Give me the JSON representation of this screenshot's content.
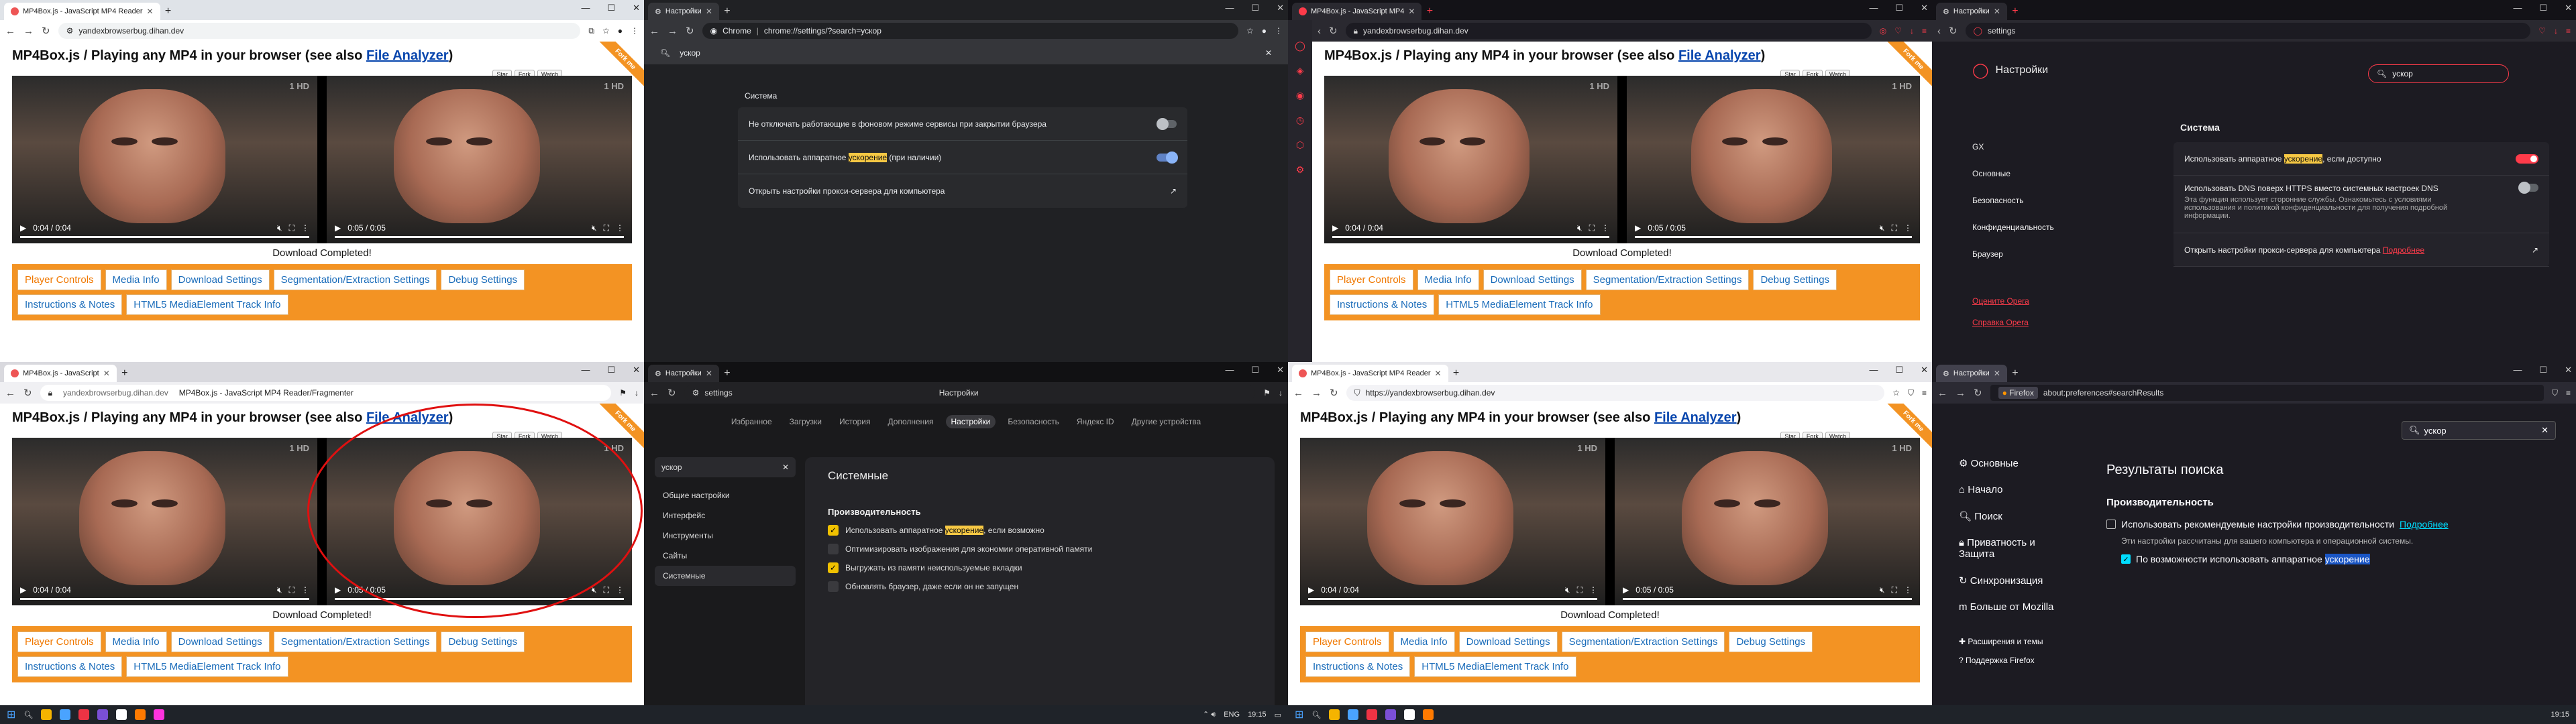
{
  "mp4page": {
    "title_prefix": "MP4Box.js / Playing any MP4 in your browser (see also ",
    "title_link": "File Analyzer",
    "title_suffix": ")",
    "ribbon": "Fork me",
    "gh_star": "Star",
    "gh_fork": "Fork",
    "gh_watch": "Watch",
    "time1": "0:04 / 0:04",
    "time2": "0:05 / 0:05",
    "download_text": "Download Completed!",
    "tabs": [
      "Player Controls",
      "Media Info",
      "Download Settings",
      "Segmentation/Extraction Settings",
      "Debug Settings",
      "Instructions & Notes",
      "HTML5 MediaElement Track Info"
    ],
    "tv_logo": "1 HD",
    "badge": "ЖИЗНИ"
  },
  "win_tl": {
    "tab": "MP4Box.js - JavaScript MP4 Reader",
    "url": "yandexbrowserbug.dihan.dev"
  },
  "win_chrome_settings": {
    "tab": "Настройки",
    "url_prefix": "Chrome",
    "url": "chrome://settings/?search=ускор",
    "search": "ускор",
    "section": "Система",
    "row1": "Не отключать работающие в фоновом режиме сервисы при закрытии браузера",
    "row2_a": "Использовать аппаратное ",
    "row2_hl": "ускорение",
    "row2_b": " (при наличии)",
    "row3": "Открыть настройки прокси-сервера для компьютера"
  },
  "win_opera_mp4": {
    "tab": "MP4Box.js - JavaScript MP4",
    "url": "yandexbrowserbug.dihan.dev"
  },
  "win_opera_settings": {
    "tab": "Настройки",
    "url": "settings",
    "header": "Настройки",
    "search": "ускор",
    "nav": [
      "GX",
      "Основные",
      "Безопасность",
      "Конфиденциальность",
      "Браузер"
    ],
    "links": [
      "Оцените Opera",
      "Справка Opera"
    ],
    "section": "Система",
    "row1_a": "Использовать аппаратное ",
    "row1_hl": "ускорение",
    "row1_b": ", если доступно",
    "row2_title": "Использовать DNS поверх HTTPS вместо системных настроек DNS",
    "row2_desc": "Эта функция использует сторонние службы. Ознакомьтесь с условиями использования и политикой конфиденциальности для получения подробной информации.",
    "row3": "Открыть настройки прокси-сервера для компьютера",
    "row3_link": "Подробнее"
  },
  "win_yandex_mp4": {
    "tab": "MP4Box.js - JavaScript",
    "url": "yandexbrowserbug.dihan.dev",
    "page_title": "MP4Box.js - JavaScript MP4 Reader/Fragmenter"
  },
  "win_yandex_settings": {
    "tab": "Настройки",
    "url": "settings",
    "page_title": "Настройки",
    "top_tabs": [
      "Избранное",
      "Загрузки",
      "История",
      "Дополнения",
      "Настройки",
      "Безопасность",
      "Яндекс ID",
      "Другие устройства"
    ],
    "search": "ускор",
    "left": [
      "Общие настройки",
      "Интерфейс",
      "Инструменты",
      "Сайты",
      "Системные"
    ],
    "main_title": "Системные",
    "group": "Производительность",
    "opt1_a": "Использовать аппаратное ",
    "opt1_hl": "ускорение",
    "opt1_b": ", если возможно",
    "opt2": "Оптимизировать изображения для экономии оперативной памяти",
    "opt3": "Выгружать из памяти неиспользуемые вкладки",
    "opt4": "Обновлять браузер, даже если он не запущен"
  },
  "win_edge_mp4": {
    "tab": "MP4Box.js - JavaScript MP4 Reader",
    "url": "https://yandexbrowserbug.dihan.dev"
  },
  "win_firefox": {
    "tab": "Настройки",
    "url_brand": "Firefox",
    "url": "about:preferences#searchResults",
    "search": "ускор",
    "side": [
      "Основные",
      "Начало",
      "Поиск",
      "Приватность и Защита",
      "Синхронизация",
      "Больше от Mozilla"
    ],
    "side_bottom": [
      "Расширения и темы",
      "Поддержка Firefox"
    ],
    "results_title": "Результаты поиска",
    "group": "Производительность",
    "opt1": "Использовать рекомендуемые настройки производительности",
    "opt1_link": "Подробнее",
    "opt1_desc": "Эти настройки рассчитаны для вашего компьютера и операционной системы.",
    "opt2_a": "По возможности использовать аппаратное ",
    "opt2_hl": "ускорение"
  },
  "taskbar": {
    "lang": "ENG",
    "time1": "19:15",
    "time2": "19:15"
  },
  "colors": {
    "orange": "#f39323",
    "link": "#0645ad",
    "opera_red": "#ff3b4a",
    "highlight": "#f6c844",
    "ff_blue": "#00ddff"
  }
}
